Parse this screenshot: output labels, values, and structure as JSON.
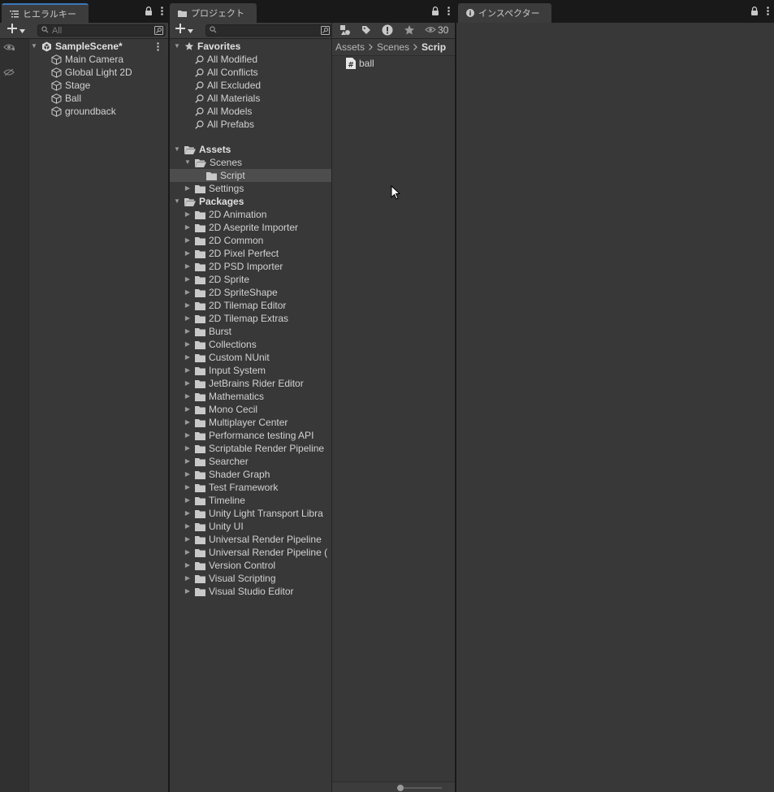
{
  "hierarchy": {
    "tab_title": "ヒエラルキー",
    "search_placeholder": "All",
    "scene_name": "SampleScene*",
    "objects": [
      "Main Camera",
      "Global Light 2D",
      "Stage",
      "Ball",
      "groundback"
    ]
  },
  "project": {
    "tab_title": "プロジェクト",
    "visible_count": "30",
    "favorites_header": "Favorites",
    "favorites": [
      "All Modified",
      "All Conflicts",
      "All Excluded",
      "All Materials",
      "All Models",
      "All Prefabs"
    ],
    "assets_header": "Assets",
    "scenes_label": "Scenes",
    "script_label": "Script",
    "settings_label": "Settings",
    "packages_header": "Packages",
    "packages": [
      "2D Animation",
      "2D Aseprite Importer",
      "2D Common",
      "2D Pixel Perfect",
      "2D PSD Importer",
      "2D Sprite",
      "2D SpriteShape",
      "2D Tilemap Editor",
      "2D Tilemap Extras",
      "Burst",
      "Collections",
      "Custom NUnit",
      "Input System",
      "JetBrains Rider Editor",
      "Mathematics",
      "Mono Cecil",
      "Multiplayer Center",
      "Performance testing API",
      "Scriptable Render Pipeline",
      "Searcher",
      "Shader Graph",
      "Test Framework",
      "Timeline",
      "Unity Light Transport Libra",
      "Unity UI",
      "Universal Render Pipeline",
      "Universal Render Pipeline (",
      "Version Control",
      "Visual Scripting",
      "Visual Studio Editor"
    ],
    "breadcrumb": [
      "Assets",
      "Scenes",
      "Scrip"
    ],
    "files": [
      {
        "name": "ball",
        "icon": "csharp-script-icon"
      }
    ]
  },
  "inspector": {
    "tab_title": "インスペクター"
  },
  "colors": {
    "panel_bg": "#383838",
    "selection_bg": "#4d4d4d",
    "tab_accent": "#3a79bb"
  }
}
